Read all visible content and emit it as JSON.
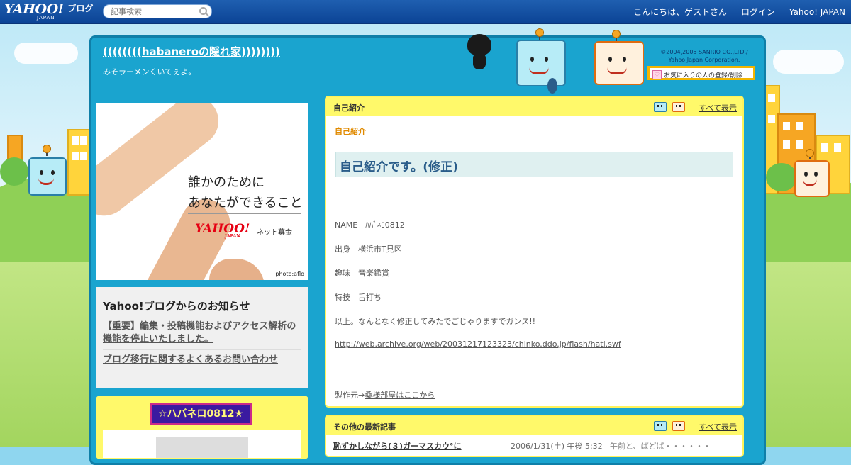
{
  "header": {
    "logo_main": "YAHOO!",
    "logo_sub": "JAPAN",
    "logo_blog": "ブログ",
    "search_placeholder": "記事検索",
    "greeting": "こんにちは、ゲストさん",
    "login": "ログイン",
    "yahoo_japan": "Yahoo! JAPAN"
  },
  "blog": {
    "title": "((((((((habaneroの隠れ家))))))))",
    "description": "みそラーメンくいてぇよ。",
    "copyright_1": "©2004,2005 SANRIO CO.,LTD./",
    "copyright_2": "Yahoo Japan Corporation.",
    "fav_button": "お気に入りの人の登録/削除",
    "fav_icon_glyph": "♡"
  },
  "ad": {
    "line1": "誰かのために",
    "line2": "あなたができること",
    "brand": "YAHOO!",
    "brand_sub": "JAPAN",
    "service": "ネット募金",
    "credit": "photo:aflo"
  },
  "notice": {
    "title": "Yahoo!ブログからのお知らせ",
    "links": [
      "【重要】編集・投稿機能およびアクセス解析の機能を停止いたしました。",
      "ブログ移行に関するよくあるお問い合わせ"
    ]
  },
  "badge": {
    "text": "☆ハバネロ0812★"
  },
  "intro_panel": {
    "header": "自己紹介",
    "show_all": "すべて表示",
    "category": "自己紹介",
    "entry_title": "自己紹介です。(修正)",
    "lines": [
      "NAME　ﾊﾊﾞﾈﾛ0812",
      "出身　横浜市T見区",
      "趣味　音楽鑑賞",
      "特技　舌打ち",
      "以上。なんとなく修正してみたでごじゃりますでガンス!!"
    ],
    "link": "http://web.archive.org/web/20031217123323/chinko.ddo.jp/flash/hati.swf",
    "credit_prefix": "製作元→",
    "credit_link": "桑様部屋はここから"
  },
  "latest_panel": {
    "header": "その他の最新記事",
    "show_all": "すべて表示",
    "rows": [
      {
        "title": "恥ずかしながら(３)ガーマスカウ°に",
        "date": "2006/1/31(土) 午後 5:32",
        "comment": "午前と、ぱどぱ・・・・・・"
      }
    ]
  },
  "colors": {
    "topbar": "#0c4496",
    "frame": "#1aa4cf",
    "panel_header": "#fff96a",
    "entry_title": "#2a5d8a",
    "category_link": "#e08a00"
  }
}
